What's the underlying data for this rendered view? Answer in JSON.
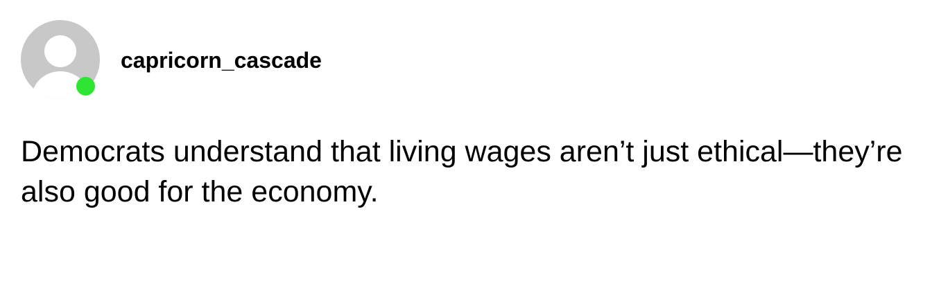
{
  "post": {
    "username": "capricorn_cascade",
    "text": "Democrats understand that living wages aren’t just ethical—they’re also good for the economy.",
    "avatar_icon": "default-user-avatar-icon",
    "status": {
      "icon": "online-status-indicator",
      "color": "#2ee533"
    },
    "colors": {
      "avatar_fill": "#c8c8c8",
      "background": "#ffffff",
      "text": "#000000"
    }
  }
}
